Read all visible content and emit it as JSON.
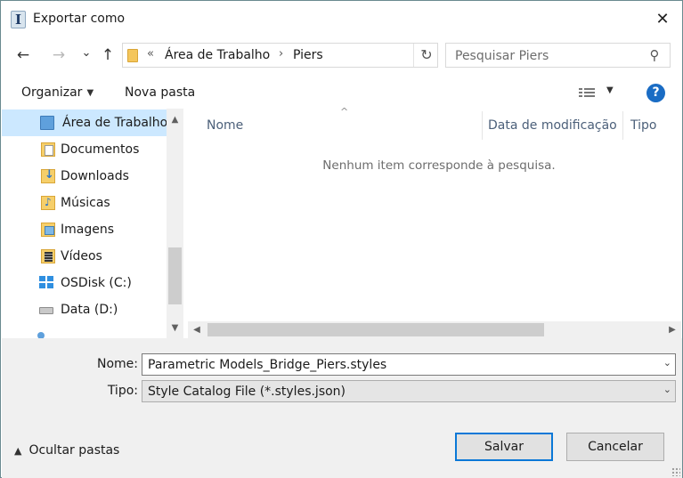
{
  "window": {
    "title": "Exportar como",
    "close_glyph": "✕"
  },
  "navigation": {
    "back_glyph": "←",
    "forward_glyph": "→",
    "recent_glyph": "⌄",
    "up_glyph": "↑"
  },
  "address_bar": {
    "overflow_glyph": "«",
    "breadcrumbs": [
      "Área de Trabalho",
      "Piers"
    ],
    "separator_glyph": "›",
    "refresh_glyph": "↻"
  },
  "search": {
    "placeholder": "Pesquisar Piers",
    "icon_glyph": "⚲"
  },
  "toolbar": {
    "organize_label": "Organizar",
    "new_folder_label": "Nova pasta",
    "help_glyph": "?"
  },
  "nav_pane": {
    "items": [
      {
        "label": "Área de Trabalho",
        "icon": "desktop-icon",
        "selected": true
      },
      {
        "label": "Documentos",
        "icon": "documents-icon"
      },
      {
        "label": "Downloads",
        "icon": "downloads-icon"
      },
      {
        "label": "Músicas",
        "icon": "music-icon"
      },
      {
        "label": "Imagens",
        "icon": "pictures-icon"
      },
      {
        "label": "Vídeos",
        "icon": "videos-icon"
      },
      {
        "label": "OSDisk (C:)",
        "icon": "windows-drive-icon"
      },
      {
        "label": "Data (D:)",
        "icon": "drive-icon"
      }
    ],
    "scroll_up_glyph": "▲",
    "scroll_down_glyph": "▼"
  },
  "content": {
    "columns": [
      "Nome",
      "Data de modificação",
      "Tipo"
    ],
    "empty_message": "Nenhum item corresponde à pesquisa.",
    "sort_glyph": "^",
    "scroll_left_glyph": "◀",
    "scroll_right_glyph": "▶"
  },
  "form": {
    "name_label": "Nome:",
    "name_value": "Parametric Models_Bridge_Piers.styles",
    "type_label": "Tipo:",
    "type_value": "Style Catalog File (*.styles.json)",
    "dropdown_glyph": "⌄"
  },
  "footer": {
    "hide_folders_label": "Ocultar pastas",
    "hide_folders_glyph": "▲",
    "save_label": "Salvar",
    "cancel_label": "Cancelar"
  },
  "colors": {
    "accent": "#0a78d7",
    "selection": "#cce8ff",
    "help": "#1a6cc4"
  }
}
